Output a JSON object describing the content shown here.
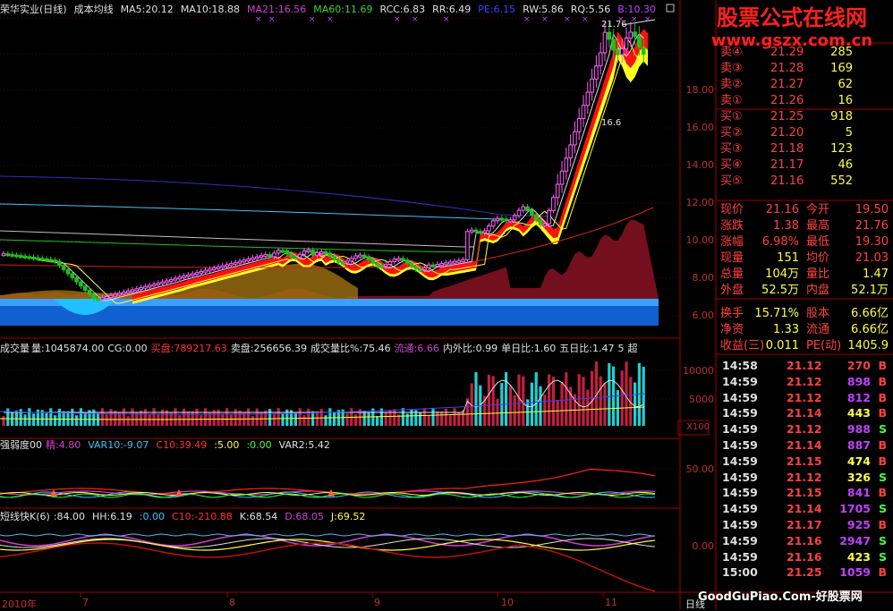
{
  "header": {
    "title": "荣华实业(日线)",
    "indicator": "成本均线",
    "ma5": "MA5:20.12",
    "ma10": "MA10:18.88",
    "ma21": "MA21:16.56",
    "ma60": "MA60:11.69",
    "rcc": "RCC:6.83",
    "rr": "RR:6.49",
    "pe": "PE:6.15",
    "rw": "RW:5.86",
    "rq": "RQ:5.56",
    "b": "B:10.30"
  },
  "chart_data": {
    "type": "candlestick",
    "y_ticks": [
      "18.00",
      "16.00",
      "14.00",
      "12.00",
      "10.00",
      "8.00",
      "6.00"
    ],
    "high_label": "21.76",
    "low_label": "16.6",
    "x_ticks": [
      "2010年",
      "7",
      "8",
      "9",
      "10",
      "11"
    ],
    "period": "日线"
  },
  "vol_panel": {
    "name": "成交量",
    "vol": "量:1045874.00",
    "cg": "CG:0.00",
    "buy_label": "买盘:789217.63",
    "sell_label": "卖盘:256656.39",
    "ratio": "成交量比%:75.46",
    "float": "流通:6.66",
    "inout": "内外比:0.99",
    "day": "单日比:1.60",
    "five": "五日比:1.47",
    "misc": "5",
    "misc2": "超",
    "ticks": [
      "10000",
      "5000"
    ],
    "unit": "X100"
  },
  "str_panel": {
    "name": "强弱度00",
    "a": "精:4.80",
    "b": "VAR10:-9.07",
    "c": "C10:39.49",
    "d": ":5.00",
    "e": ":0.00",
    "f": "VAR2:5.42",
    "ticks": [
      "50.00",
      "0.00"
    ]
  },
  "kd_panel": {
    "name": "短线快K(6)",
    "a": ":84.00",
    "b": "HH:6.19",
    "c": ":0.00",
    "d": "C10:-210.88",
    "e": "K:68.54",
    "f": "D:68.05",
    "g": "J:69.52",
    "ticks": [
      "0.00"
    ]
  },
  "watermark": {
    "line1": "股票公式在线网",
    "line2": "www.gszx.com.cn"
  },
  "orderbook": [
    {
      "label": "卖④",
      "price": "21.29",
      "vol": "285"
    },
    {
      "label": "卖③",
      "price": "21.28",
      "vol": "169"
    },
    {
      "label": "卖②",
      "price": "21.27",
      "vol": "62"
    },
    {
      "label": "卖①",
      "price": "21.26",
      "vol": "16"
    },
    {
      "label": "买①",
      "price": "21.25",
      "vol": "918"
    },
    {
      "label": "买②",
      "price": "21.20",
      "vol": "5"
    },
    {
      "label": "买③",
      "price": "21.18",
      "vol": "123"
    },
    {
      "label": "买④",
      "price": "21.17",
      "vol": "46"
    },
    {
      "label": "买⑤",
      "price": "21.16",
      "vol": "552"
    }
  ],
  "quote": [
    {
      "l1": "现价",
      "v1": "21.16",
      "l2": "今开",
      "v2": "19.50"
    },
    {
      "l1": "涨跌",
      "v1": "1.38",
      "l2": "最高",
      "v2": "21.76"
    },
    {
      "l1": "涨幅",
      "v1": "6.98%",
      "l2": "最低",
      "v2": "19.30"
    },
    {
      "l1": "现量",
      "v1": "151",
      "l2": "均价",
      "v2": "21.03"
    },
    {
      "l1": "总量",
      "v1": "104万",
      "l2": "量比",
      "v2": "1.47"
    },
    {
      "l1": "外盘",
      "v1": "52.5万",
      "l2": "内盘",
      "v2": "52.1万"
    }
  ],
  "fund": [
    {
      "l1": "换手",
      "v1": "15.71%",
      "l2": "股本",
      "v2": "6.66亿"
    },
    {
      "l1": "净资",
      "v1": "1.33",
      "l2": "流通",
      "v2": "6.66亿"
    },
    {
      "l1": "收益(三)",
      "v1": "0.011",
      "l2": "PE(动)",
      "v2": "1405.9"
    }
  ],
  "ticks": [
    {
      "t": "14:58",
      "p": "21.12",
      "v": "270",
      "s": "B",
      "c": "#ff4040"
    },
    {
      "t": "14:59",
      "p": "21.12",
      "v": "898",
      "s": "B",
      "c": "#c040ff"
    },
    {
      "t": "14:59",
      "p": "21.12",
      "v": "812",
      "s": "B",
      "c": "#c040ff"
    },
    {
      "t": "14:59",
      "p": "21.14",
      "v": "443",
      "s": "B",
      "c": "#ffff40"
    },
    {
      "t": "14:59",
      "p": "21.12",
      "v": "988",
      "s": "S",
      "c": "#c040ff"
    },
    {
      "t": "14:59",
      "p": "21.14",
      "v": "887",
      "s": "B",
      "c": "#c040ff"
    },
    {
      "t": "14:59",
      "p": "21.15",
      "v": "474",
      "s": "B",
      "c": "#ffff40"
    },
    {
      "t": "14:59",
      "p": "21.12",
      "v": "326",
      "s": "S",
      "c": "#ffff40"
    },
    {
      "t": "14:59",
      "p": "21.15",
      "v": "841",
      "s": "B",
      "c": "#c040ff"
    },
    {
      "t": "14:59",
      "p": "21.14",
      "v": "1705",
      "s": "S",
      "c": "#c040ff"
    },
    {
      "t": "14:59",
      "p": "21.17",
      "v": "925",
      "s": "B",
      "c": "#c040ff"
    },
    {
      "t": "14:59",
      "p": "21.16",
      "v": "2947",
      "s": "S",
      "c": "#c040ff"
    },
    {
      "t": "14:59",
      "p": "21.16",
      "v": "423",
      "s": "S",
      "c": "#ffff40"
    },
    {
      "t": "15:00",
      "p": "21.25",
      "v": "1059",
      "s": "B",
      "c": "#c040ff"
    }
  ],
  "footer": "GoodGuPiao.Com-好股票网"
}
